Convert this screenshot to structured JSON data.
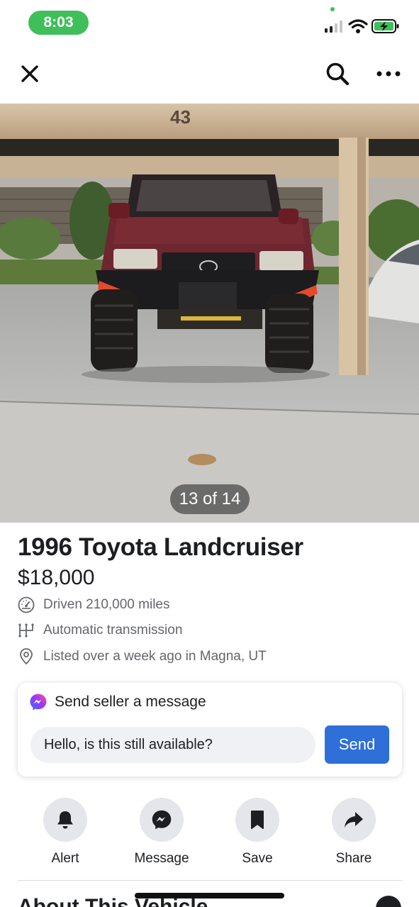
{
  "status_bar": {
    "time": "8:03",
    "icons": [
      "signal-icon",
      "wifi-icon",
      "battery-charging-icon"
    ],
    "accent_color": "#3fbf5a"
  },
  "top_nav": {
    "icons": [
      "close-icon",
      "search-icon",
      "more-options-icon"
    ]
  },
  "photo": {
    "counter": "13 of 14",
    "current_index": 13,
    "total": 14,
    "spot_number": "43"
  },
  "listing": {
    "title": "1996 Toyota Landcruiser",
    "price": "$18,000",
    "details": [
      {
        "icon": "speedometer-icon",
        "text": "Driven 210,000 miles"
      },
      {
        "icon": "transmission-icon",
        "text": "Automatic transmission"
      },
      {
        "icon": "location-pin-icon",
        "text": "Listed over a week ago in Magna, UT"
      }
    ]
  },
  "message": {
    "heading": "Send seller a message",
    "input_value": "Hello, is this still available?",
    "send_label": "Send",
    "brand_color": "#2e6fd8"
  },
  "actions": [
    {
      "icon": "bell-icon",
      "label": "Alert"
    },
    {
      "icon": "messenger-icon",
      "label": "Message"
    },
    {
      "icon": "bookmark-icon",
      "label": "Save"
    },
    {
      "icon": "share-arrow-icon",
      "label": "Share"
    }
  ],
  "about_section": {
    "heading": "About This Vehicle"
  }
}
